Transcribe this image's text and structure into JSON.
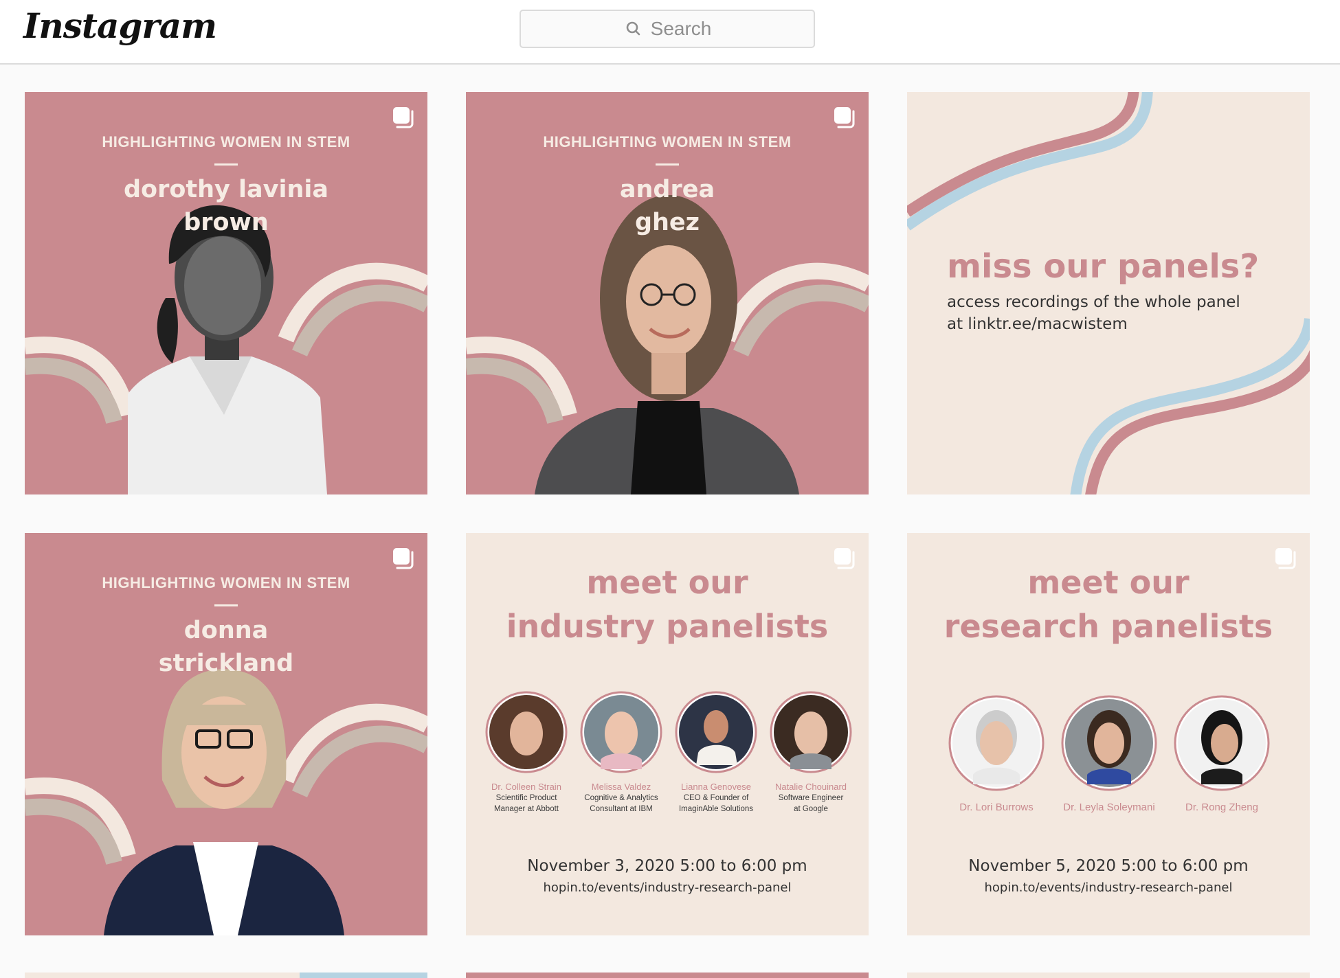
{
  "header": {
    "logo_text": "Instagram",
    "search_placeholder": "Search"
  },
  "posts": [
    {
      "kicker": "HIGHLIGHTING WOMEN IN STEM",
      "name_line1": "dorothy lavinia",
      "name_line2": "brown",
      "multi_icon": "multiple-images-icon"
    },
    {
      "kicker": "HIGHLIGHTING WOMEN IN STEM",
      "name_line1": "andrea",
      "name_line2": "ghez",
      "multi_icon": "multiple-images-icon"
    },
    {
      "title": "miss our panels?",
      "subtitle_line1": "access recordings of the whole panel",
      "subtitle_line2": "at linktr.ee/macwistem"
    },
    {
      "kicker": "HIGHLIGHTING WOMEN IN STEM",
      "name_line1": "donna",
      "name_line2": "strickland",
      "multi_icon": "multiple-images-icon"
    },
    {
      "title_line1": "meet our",
      "title_line2": "industry panelists",
      "panelists": [
        {
          "name": "Dr. Colleen Strain",
          "role_line1": "Scientific Product",
          "role_line2": "Manager at Abbott"
        },
        {
          "name": "Melissa Valdez",
          "role_line1": "Cognitive & Analytics",
          "role_line2": "Consultant at IBM"
        },
        {
          "name": "Lianna Genovese",
          "role_line1": "CEO & Founder of",
          "role_line2": "ImaginAble Solutions"
        },
        {
          "name": "Natalie Chouinard",
          "role_line1": "Software Engineer",
          "role_line2": "at Google"
        }
      ],
      "date": "November 3, 2020 5:00 to 6:00 pm",
      "url": "hopin.to/events/industry-research-panel",
      "multi_icon": "multiple-images-icon"
    },
    {
      "title_line1": "meet our",
      "title_line2": "research panelists",
      "panelists": [
        {
          "name": "Dr. Lori Burrows"
        },
        {
          "name": "Dr. Leyla Soleymani"
        },
        {
          "name": "Dr. Rong Zheng"
        }
      ],
      "date": "November 5, 2020 5:00 to 6:00 pm",
      "url": "hopin.to/events/industry-research-panel",
      "multi_icon": "multiple-images-icon"
    }
  ],
  "colors": {
    "pink": "#c98a8f",
    "cream": "#f3e8df",
    "blue": "#b5d3e2",
    "taupe": "#c7b9ae"
  }
}
